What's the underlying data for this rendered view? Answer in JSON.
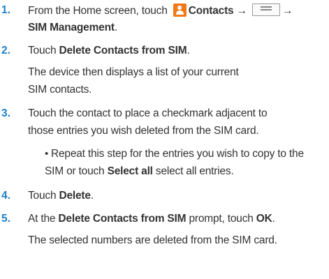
{
  "steps": [
    {
      "number": "1.",
      "text_before": "From the Home screen, touch",
      "contacts_label": "Contacts",
      "arrow1": "→",
      "arrow2": "→",
      "sim_management": "SIM Management",
      "period": "."
    },
    {
      "number": "2.",
      "text_before": "Touch",
      "bold": "Delete Contacts from SIM",
      "period": ".",
      "note_line1": "The device then displays a list of your current",
      "note_line2": "SIM contacts."
    },
    {
      "number": "3.",
      "line1": "Touch the contact to place a checkmark adjacent to",
      "line2": "those entries you wish deleted from the SIM card.",
      "bullet": "•",
      "bullet_line1": "Repeat this step for the entries you wish to copy to the",
      "bullet_line2_before": "SIM or touch",
      "bullet_line2_bold": "Select all",
      "bullet_line2_after": "select all entries."
    },
    {
      "number": "4.",
      "text_before": "Touch",
      "bold": "Delete",
      "period": "."
    },
    {
      "number": "5.",
      "text_before": "At the",
      "bold": "Delete Contacts from SIM",
      "text_middle": "prompt, touch",
      "bold2": "OK",
      "period": ".",
      "note": "The selected numbers are deleted from the SIM card."
    }
  ],
  "colors": {
    "step_number": "#1f7fc8",
    "contacts_icon": "#f07a1a",
    "text": "#333333"
  },
  "icons": [
    "contacts-icon",
    "menu-icon"
  ]
}
